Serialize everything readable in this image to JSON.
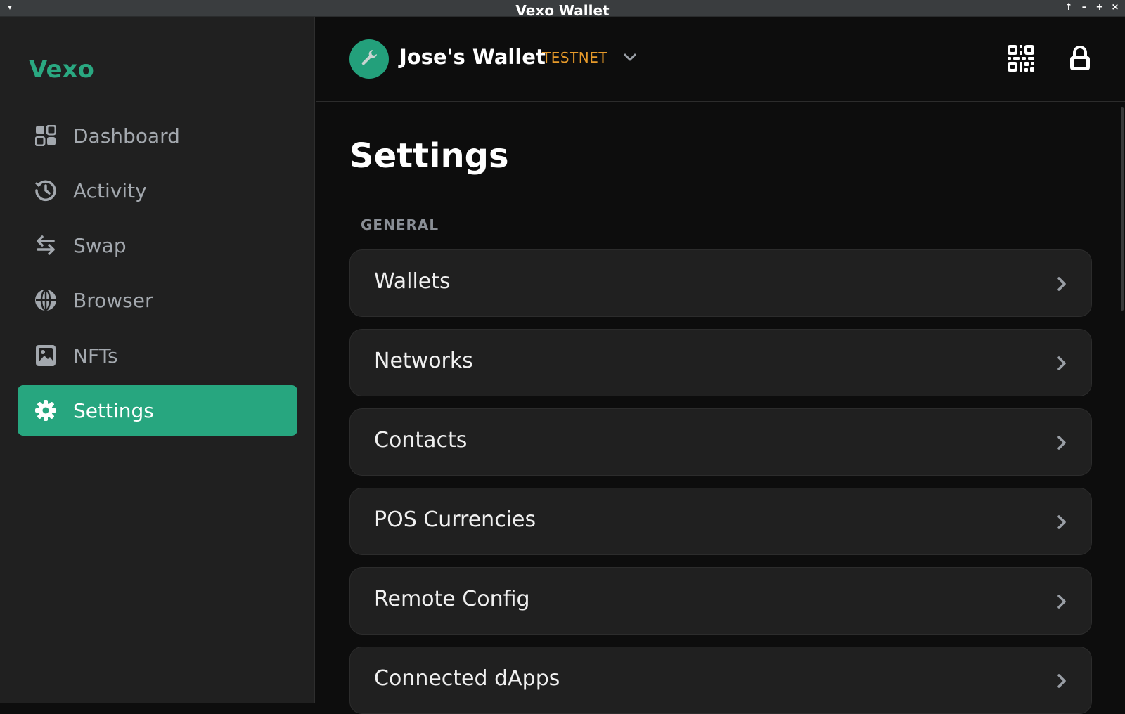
{
  "window": {
    "title": "Vexo Wallet"
  },
  "sidebar": {
    "logo": "Vexo",
    "items": [
      {
        "label": "Dashboard",
        "icon": "dashboard-icon"
      },
      {
        "label": "Activity",
        "icon": "history-icon"
      },
      {
        "label": "Swap",
        "icon": "swap-arrows-icon"
      },
      {
        "label": "Browser",
        "icon": "globe-icon"
      },
      {
        "label": "NFTs",
        "icon": "image-icon"
      },
      {
        "label": "Settings",
        "icon": "gear-icon",
        "active": true
      }
    ]
  },
  "header": {
    "avatar_icon": "wrench-icon",
    "wallet_name": "Jose's Wallet",
    "network": "TESTNET"
  },
  "main": {
    "title": "Settings",
    "section": "GENERAL",
    "rows": [
      {
        "label": "Wallets"
      },
      {
        "label": "Networks"
      },
      {
        "label": "Contacts"
      },
      {
        "label": "POS Currencies"
      },
      {
        "label": "Remote Config"
      },
      {
        "label": "Connected dApps"
      }
    ]
  },
  "colors": {
    "accent": "#27a67f",
    "network_badge": "#e69a2a",
    "sidebar_bg": "#202020",
    "main_bg": "#0d0d0d",
    "row_bg": "#202020"
  }
}
